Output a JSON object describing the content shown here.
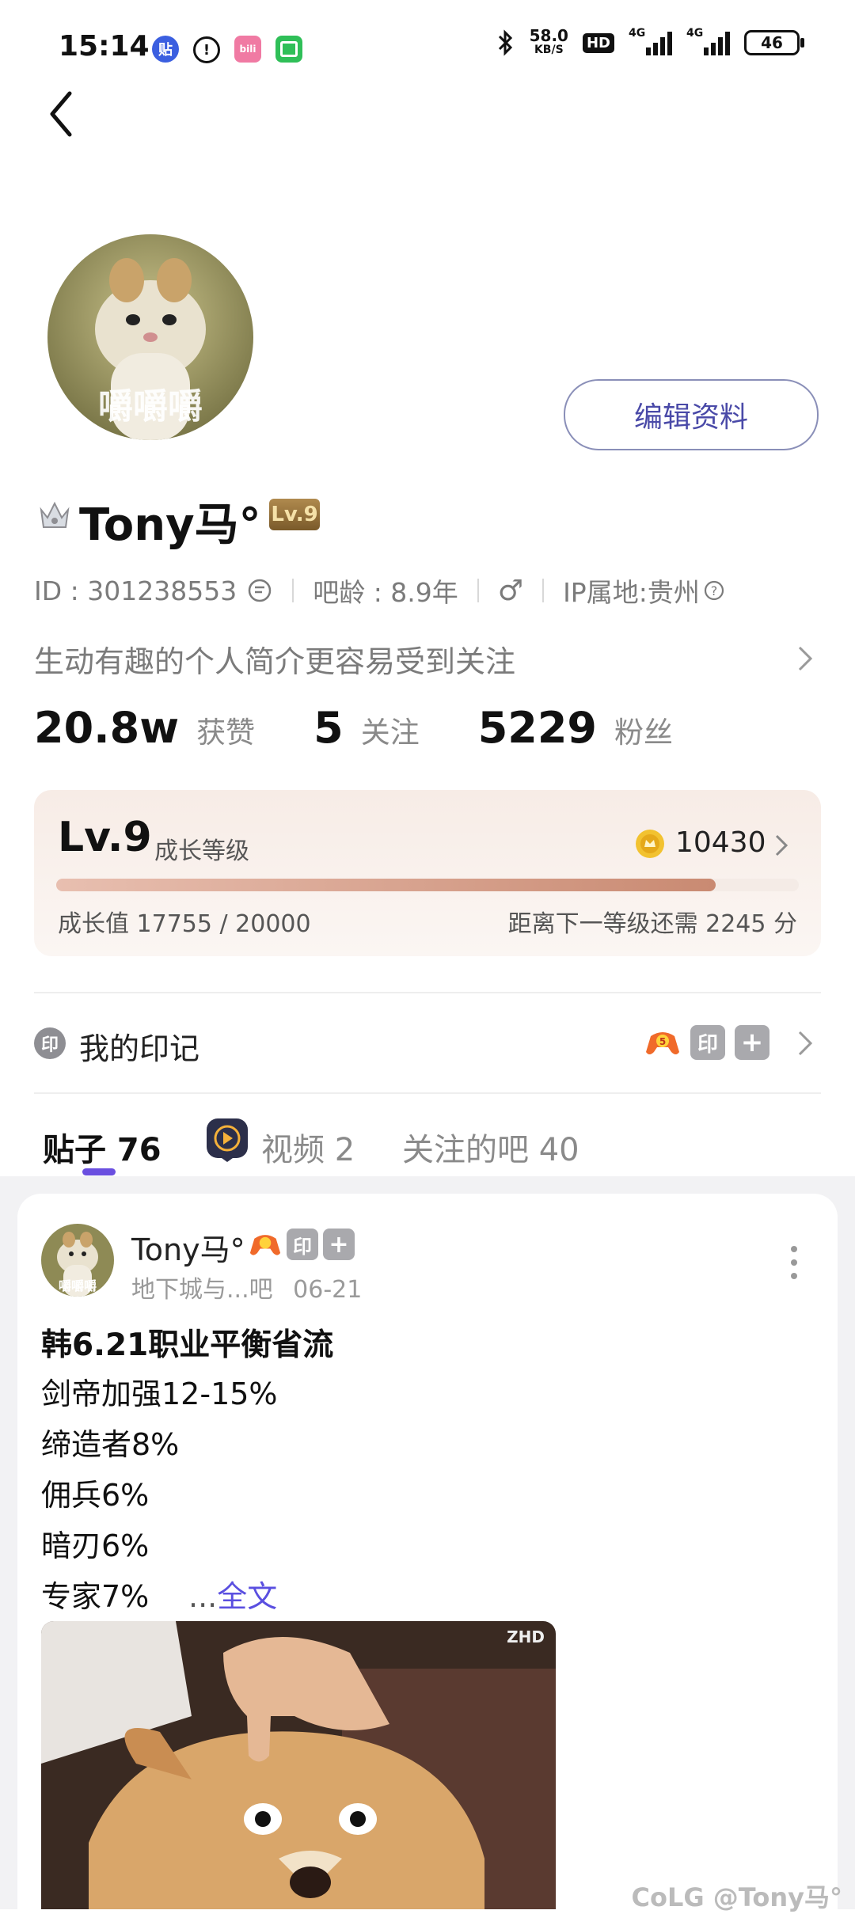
{
  "status_bar": {
    "time": "15:14",
    "app_icons": [
      {
        "name": "tieba-app-icon",
        "glyph": "贴",
        "color": "#3b5fe0"
      },
      {
        "name": "alert-icon",
        "glyph": "!",
        "color": "#111111"
      },
      {
        "name": "bilibili-icon",
        "glyph": "bili",
        "color": "#f07aa3"
      },
      {
        "name": "green-app-icon",
        "glyph": "◻",
        "color": "#2fbf58"
      }
    ],
    "net_speed_value": "58.0",
    "net_speed_unit": "KB/S",
    "hd_label": "HD",
    "net1": "4G",
    "net2": "4G",
    "battery": "46"
  },
  "profile": {
    "edit_button": "编辑资料",
    "username": "Tony马°",
    "level_badge": "Lv.9",
    "id_text": "ID : 301238553",
    "age_text": "吧龄 : 8.9年",
    "gender_symbol": "♂",
    "ip_text": "IP属地:贵州",
    "bio_placeholder": "生动有趣的个人简介更容易受到关注",
    "stats": [
      {
        "value": "20.8w",
        "label": "获赞"
      },
      {
        "value": "5",
        "label": "关注"
      },
      {
        "value": "5229",
        "label": "粉丝"
      }
    ]
  },
  "level_card": {
    "level": "Lv.9",
    "subtitle": "成长等级",
    "coins": "10430",
    "growth_text": "成长值 17755 / 20000",
    "next_text": "距离下一等级还需 2245 分",
    "progress": 0.8878
  },
  "marks": {
    "icon_glyph": "印",
    "label": "我的印记",
    "badge_glyph": "印",
    "plus_glyph": "+"
  },
  "tabs": [
    {
      "label": "贴子 76",
      "active": true
    },
    {
      "label": "视频 2",
      "active": false
    },
    {
      "label": "关注的吧 40",
      "active": false
    }
  ],
  "post": {
    "author": "Tony马°",
    "badge_glyph": "印",
    "plus_glyph": "+",
    "forum": "地下城与...吧",
    "date": "06-21",
    "title": "韩6.21职业平衡省流",
    "lines": [
      "剑帝加强12-15%",
      "缔造者8%",
      "佣兵6%",
      "暗刃6%",
      "专家7%"
    ],
    "read_more_dots": "...",
    "read_more_link": "全文",
    "image_tag": "ZHD",
    "avatar_caption": "嚼嚼嚼"
  },
  "watermark": "CoLG @Tony马°",
  "colors": {
    "accent": "#5a4fe0",
    "tab_underline": "#6a4fe0"
  }
}
